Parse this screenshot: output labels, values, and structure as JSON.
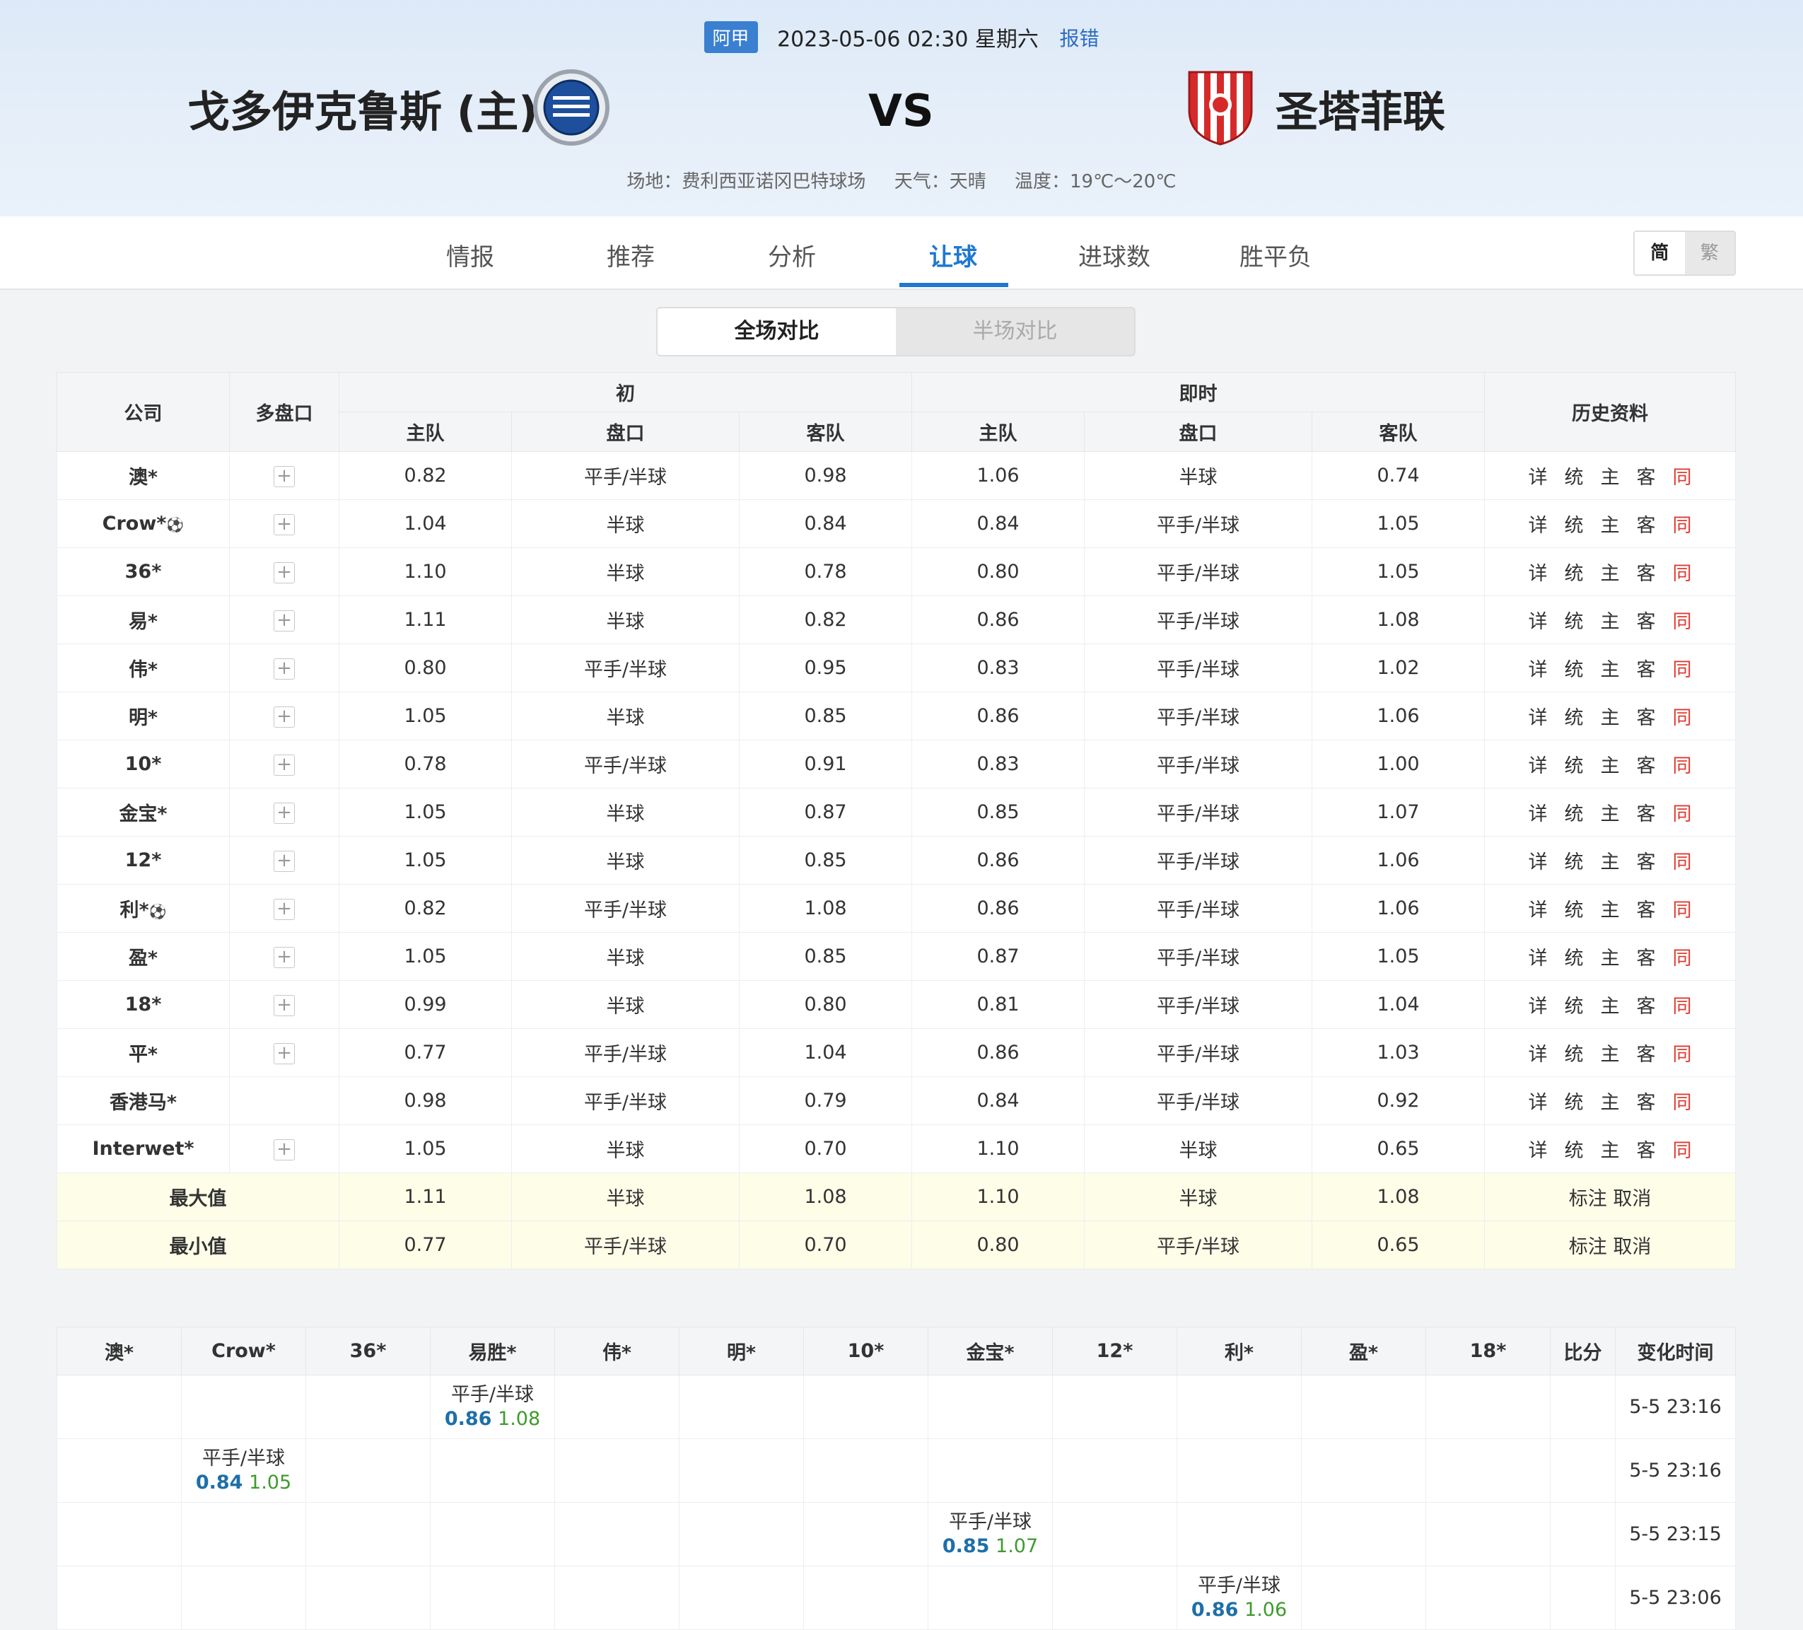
{
  "header": {
    "league": "阿甲",
    "datetime": "2023-05-06 02:30 星期六",
    "report": "报错",
    "home_team": "戈多伊克鲁斯 (主)",
    "vs": "VS",
    "away_team": "圣塔菲联",
    "venue": "场地：费利西亚诺冈巴特球场",
    "weather": "天气：天晴",
    "temperature": "温度：19℃～20℃"
  },
  "nav": {
    "tabs": [
      "情报",
      "推荐",
      "分析",
      "让球",
      "进球数",
      "胜平负"
    ],
    "active_tab": "让球",
    "lang_simple": "简",
    "lang_trad": "繁"
  },
  "switch": {
    "full": "全场对比",
    "half": "半场对比"
  },
  "odds_table": {
    "headers": {
      "company": "公司",
      "multi": "多盘口",
      "initial": "初",
      "live": "即时",
      "home": "主队",
      "handicap": "盘口",
      "away": "客队",
      "history": "历史资料"
    },
    "history_links": [
      "详",
      "统",
      "主",
      "客",
      "同"
    ],
    "rows": [
      {
        "company": "澳*",
        "ball": "",
        "plus": true,
        "i_home": "0.82",
        "i_hcp": "平手/半球",
        "i_away": "0.98",
        "l_home": "1.06",
        "l_hcp": "半球",
        "l_away": "0.74"
      },
      {
        "company": "Crow*",
        "ball": "⚽",
        "plus": true,
        "i_home": "1.04",
        "i_hcp": "半球",
        "i_away": "0.84",
        "l_home": "0.84",
        "l_hcp": "平手/半球",
        "l_away": "1.05"
      },
      {
        "company": "36*",
        "ball": "",
        "plus": true,
        "i_home": "1.10",
        "i_hcp": "半球",
        "i_away": "0.78",
        "l_home": "0.80",
        "l_hcp": "平手/半球",
        "l_away": "1.05"
      },
      {
        "company": "易*",
        "ball": "",
        "plus": true,
        "i_home": "1.11",
        "i_hcp": "半球",
        "i_away": "0.82",
        "l_home": "0.86",
        "l_hcp": "平手/半球",
        "l_away": "1.08"
      },
      {
        "company": "伟*",
        "ball": "",
        "plus": true,
        "i_home": "0.80",
        "i_hcp": "平手/半球",
        "i_away": "0.95",
        "l_home": "0.83",
        "l_hcp": "平手/半球",
        "l_away": "1.02"
      },
      {
        "company": "明*",
        "ball": "",
        "plus": true,
        "i_home": "1.05",
        "i_hcp": "半球",
        "i_away": "0.85",
        "l_home": "0.86",
        "l_hcp": "平手/半球",
        "l_away": "1.06"
      },
      {
        "company": "10*",
        "ball": "",
        "plus": true,
        "i_home": "0.78",
        "i_hcp": "平手/半球",
        "i_away": "0.91",
        "l_home": "0.83",
        "l_hcp": "平手/半球",
        "l_away": "1.00"
      },
      {
        "company": "金宝*",
        "ball": "",
        "plus": true,
        "i_home": "1.05",
        "i_hcp": "半球",
        "i_away": "0.87",
        "l_home": "0.85",
        "l_hcp": "平手/半球",
        "l_away": "1.07"
      },
      {
        "company": "12*",
        "ball": "",
        "plus": true,
        "i_home": "1.05",
        "i_hcp": "半球",
        "i_away": "0.85",
        "l_home": "0.86",
        "l_hcp": "平手/半球",
        "l_away": "1.06"
      },
      {
        "company": "利*",
        "ball": "⚽",
        "plus": true,
        "i_home": "0.82",
        "i_hcp": "平手/半球",
        "i_away": "1.08",
        "l_home": "0.86",
        "l_hcp": "平手/半球",
        "l_away": "1.06"
      },
      {
        "company": "盈*",
        "ball": "",
        "plus": true,
        "i_home": "1.05",
        "i_hcp": "半球",
        "i_away": "0.85",
        "l_home": "0.87",
        "l_hcp": "平手/半球",
        "l_away": "1.05"
      },
      {
        "company": "18*",
        "ball": "",
        "plus": true,
        "i_home": "0.99",
        "i_hcp": "半球",
        "i_away": "0.80",
        "l_home": "0.81",
        "l_hcp": "平手/半球",
        "l_away": "1.04"
      },
      {
        "company": "平*",
        "ball": "",
        "plus": true,
        "i_home": "0.77",
        "i_hcp": "平手/半球",
        "i_away": "1.04",
        "l_home": "0.86",
        "l_hcp": "平手/半球",
        "l_away": "1.03"
      },
      {
        "company": "香港马*",
        "ball": "",
        "plus": false,
        "i_home": "0.98",
        "i_hcp": "平手/半球",
        "i_away": "0.79",
        "l_home": "0.84",
        "l_hcp": "平手/半球",
        "l_away": "0.92"
      },
      {
        "company": "Interwet*",
        "ball": "",
        "plus": true,
        "i_home": "1.05",
        "i_hcp": "半球",
        "i_away": "0.70",
        "l_home": "1.10",
        "l_hcp": "半球",
        "l_away": "0.65"
      }
    ],
    "summary": [
      {
        "label": "最大值",
        "i_home": "1.11",
        "i_hcp": "半球",
        "i_away": "1.08",
        "l_home": "1.10",
        "l_hcp": "半球",
        "l_away": "1.08",
        "actions": "标注 取消"
      },
      {
        "label": "最小值",
        "i_home": "0.77",
        "i_hcp": "平手/半球",
        "i_away": "0.70",
        "l_home": "0.80",
        "l_hcp": "平手/半球",
        "l_away": "0.65",
        "actions": "标注 取消"
      }
    ]
  },
  "change_table": {
    "headers": [
      "澳*",
      "Crow*",
      "36*",
      "易胜*",
      "伟*",
      "明*",
      "10*",
      "金宝*",
      "12*",
      "利*",
      "盈*",
      "18*",
      "比分",
      "变化时间"
    ],
    "rows": [
      {
        "col": 3,
        "hcp": "平手/半球",
        "home": "0.86",
        "away": "1.08",
        "time": "5-5 23:16"
      },
      {
        "col": 1,
        "hcp": "平手/半球",
        "home": "0.84",
        "away": "1.05",
        "time": "5-5 23:16"
      },
      {
        "col": 7,
        "hcp": "平手/半球",
        "home": "0.85",
        "away": "1.07",
        "time": "5-5 23:15"
      },
      {
        "col": 9,
        "hcp": "平手/半球",
        "home": "0.86",
        "away": "1.06",
        "time": "5-5 23:06"
      }
    ]
  },
  "colors": {
    "accent": "#1f78d1",
    "league_badge": "#3a7fd0",
    "highlight_red": "#e03a2f",
    "summary_bg": "#fdfde8"
  }
}
